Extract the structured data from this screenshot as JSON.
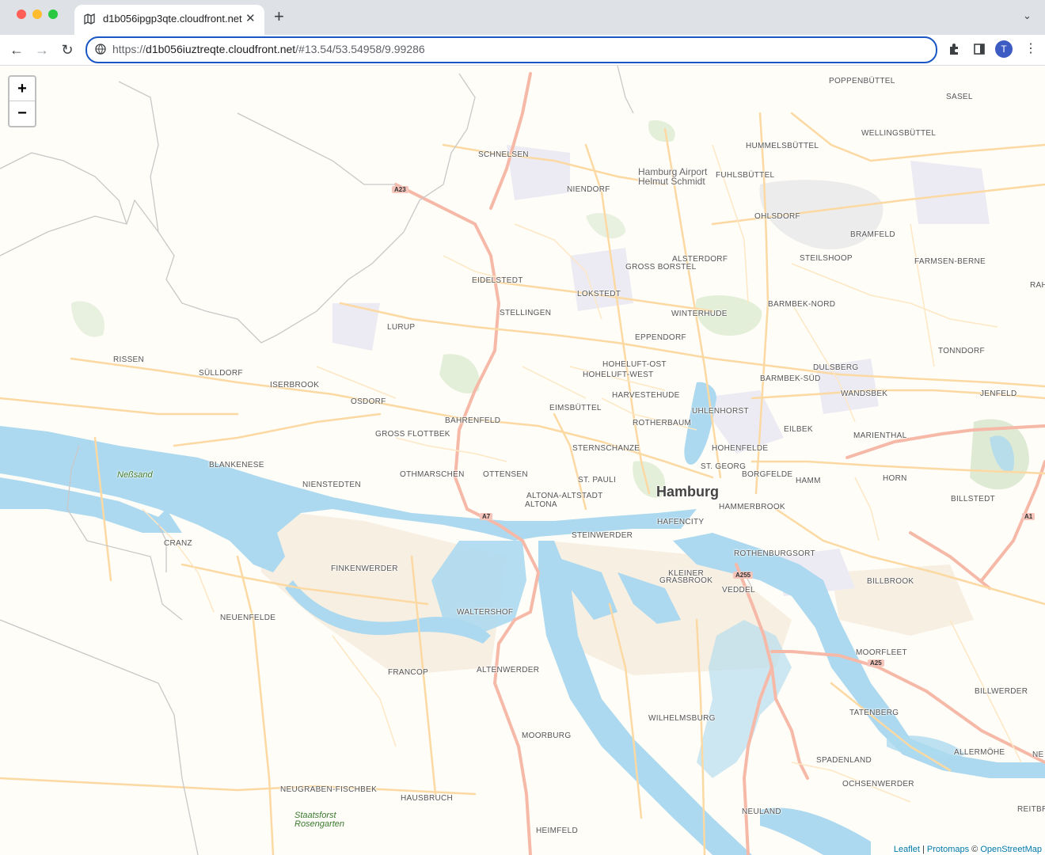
{
  "browser": {
    "tab_title": "d1b056ipgp3qte.cloudfront.net",
    "tab_close": "✕",
    "new_tab": "+",
    "url_host": "d1b056iuztreqte.cloudfront.net",
    "url_scheme": "https://",
    "url_hash": "/#13.54/53.54958/9.99286",
    "avatar_letter": "T"
  },
  "map": {
    "zoom_in": "+",
    "zoom_out": "−",
    "city": "Hamburg",
    "districts": [
      "POPPENBÜTTEL",
      "SASEL",
      "WELLINGSBÜTTEL",
      "HUMMELSBÜTTEL",
      "SCHNELSEN",
      "NIENDORF",
      "FUHLSBÜTTEL",
      "OHLSDORF",
      "BRAMFELD",
      "STEILSHOOP",
      "FARMSEN-BERNE",
      "ALSTERDORF",
      "GROSS BORSTEL",
      "EIDELSTEDT",
      "LOKSTEDT",
      "BARMBEK-NORD",
      "STELLINGEN",
      "WINTERHUDE",
      "LURUP",
      "EPPENDORF",
      "TONNDORF",
      "RISSEN",
      "HOHELUFT-OST",
      "HOHELUFT-WEST",
      "DULSBERG",
      "SÜLLDORF",
      "BARMBEK-SÜD",
      "ISERBROOK",
      "WANDSBEK",
      "JENFELD",
      "HARVESTEHUDE",
      "OSDORF",
      "EIMSBÜTTEL",
      "UHLENHORST",
      "BAHRENFELD",
      "ROTHERBAUM",
      "EILBEK",
      "GROSS FLOTTBEK",
      "MARIENTHAL",
      "STERNSCHANZE",
      "HOHENFELDE",
      "BLANKENESE",
      "ST. GEORG",
      "OTHMARSCHEN",
      "OTTENSEN",
      "BORGFELDE",
      "HAMM",
      "HORN",
      "ST. PAULI",
      "NIENSTEDTEN",
      "ALTONA-ALTSTADT",
      "ALTONA",
      "HAMMERBROOK",
      "BILLSTEDT",
      "HAFENCITY",
      "STEINWERDER",
      "CRANZ",
      "ROTHENBURGSORT",
      "FINKENWERDER",
      "KLEINER GRASBROOK",
      "VEDDEL",
      "BILLBROOK",
      "WALTERSHOF",
      "NEUENFELDE",
      "MOORFLEET",
      "FRANCOP",
      "ALTENWERDER",
      "BILLWERDER",
      "TATENBERG",
      "WILHELMSBURG",
      "MOORBURG",
      "ALLERMÖHE",
      "SPADENLAND",
      "OCHSENWERDER",
      "NEUGRABEN-FISCHBEK",
      "HAUSBRUCH",
      "NEULAND",
      "REITBR",
      "HEIMFELD",
      "RAH",
      "NE"
    ],
    "water_label": "Neßsand",
    "airport": [
      "Hamburg Airport",
      "Helmut Schmidt"
    ],
    "forest": [
      "Staatsforst",
      "Rosengarten"
    ],
    "shields": [
      "A23",
      "A7",
      "A255",
      "A25",
      "A1"
    ]
  },
  "attribution": {
    "leaflet": "Leaflet",
    "sep": "|",
    "protomaps": "Protomaps",
    "copyright": "©",
    "osm": "OpenStreetMap"
  }
}
